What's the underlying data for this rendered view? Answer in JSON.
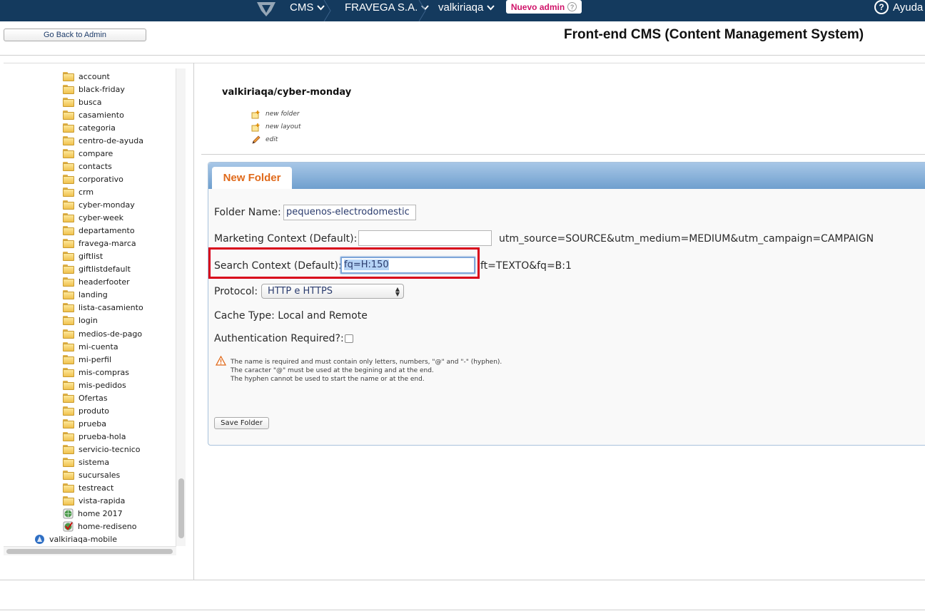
{
  "topbar": {
    "cms_label": "CMS",
    "account_label": "FRAVEGA S.A.",
    "store_label": "valkiriaqa",
    "new_admin_label": "Nuevo admin",
    "help_label": "Ayuda"
  },
  "header": {
    "back_button": "Go Back to Admin",
    "title": "Front-end CMS (Content Management System)"
  },
  "tree": {
    "folders": [
      "account",
      "black-friday",
      "busca",
      "casamiento",
      "categoria",
      "centro-de-ayuda",
      "compare",
      "contacts",
      "corporativo",
      "crm",
      "cyber-monday",
      "cyber-week",
      "departamento",
      "fravega-marca",
      "giftlist",
      "giftlistdefault",
      "headerfooter",
      "landing",
      "lista-casamiento",
      "login",
      "medios-de-pago",
      "mi-cuenta",
      "mi-perfil",
      "mis-compras",
      "mis-pedidos",
      "Ofertas",
      "produto",
      "prueba",
      "prueba-hola",
      "servicio-tecnico",
      "sistema",
      "sucursales",
      "testreact",
      "vista-rapida"
    ],
    "pages": [
      "home 2017",
      "home-rediseno"
    ],
    "site": "valkiriaqa-mobile"
  },
  "content": {
    "path_title": "valkiriaqa/cyber-monday",
    "actions": [
      "new folder",
      "new layout",
      "edit"
    ]
  },
  "form": {
    "tab_label": "New Folder",
    "folder_name_label": "Folder Name:",
    "folder_name_value": "pequenos-electrodomestic",
    "marketing_label": "Marketing Context (Default):",
    "marketing_value": "",
    "marketing_hint": "utm_source=SOURCE&utm_medium=MEDIUM&utm_campaign=CAMPAIGN",
    "search_label": "Search Context (Default):",
    "search_value": "fq=H:150",
    "search_hint": "ft=TEXTO&fq=B:1",
    "protocol_label": "Protocol:",
    "protocol_value": "HTTP e HTTPS",
    "cache_label": "Cache Type: Local and Remote",
    "auth_label": "Authentication Required?:",
    "auth_checked": false,
    "warning_lines": [
      "The name is required and must contain only letters, numbers, \"@\" and \"-\" (hyphen).",
      "The caracter \"@\" must be used at the begining and at the end.",
      "The hyphen cannot be used to start the name or at the end."
    ],
    "save_button": "Save Folder"
  },
  "colors": {
    "topbar": "#143a5e",
    "tab_text": "#e06a1b",
    "highlight": "#d8001a",
    "new_admin": "#d0146a"
  }
}
